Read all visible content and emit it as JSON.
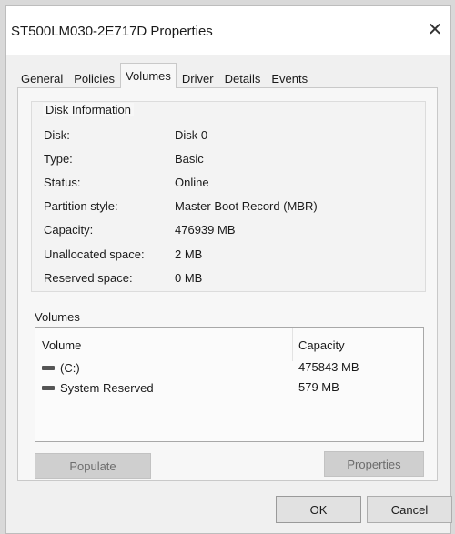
{
  "window": {
    "title": "ST500LM030-2E717D Properties",
    "close_glyph": "✕"
  },
  "tabs": [
    {
      "label": "General",
      "active": false
    },
    {
      "label": "Policies",
      "active": false
    },
    {
      "label": "Volumes",
      "active": true
    },
    {
      "label": "Driver",
      "active": false
    },
    {
      "label": "Details",
      "active": false
    },
    {
      "label": "Events",
      "active": false
    }
  ],
  "disk_info": {
    "group_title": "Disk Information",
    "rows": [
      {
        "label": "Disk:",
        "value": "Disk 0"
      },
      {
        "label": "Type:",
        "value": "Basic"
      },
      {
        "label": "Status:",
        "value": "Online"
      },
      {
        "label": "Partition style:",
        "value": "Master Boot Record (MBR)"
      },
      {
        "label": "Capacity:",
        "value": "476939 MB"
      },
      {
        "label": "Unallocated space:",
        "value": "2 MB"
      },
      {
        "label": "Reserved space:",
        "value": "0 MB"
      }
    ]
  },
  "volumes": {
    "group_title": "Volumes",
    "columns": {
      "volume": "Volume",
      "capacity": "Capacity"
    },
    "rows": [
      {
        "name": "(C:)",
        "capacity": "475843 MB",
        "icon": "drive-icon"
      },
      {
        "name": "System Reserved",
        "capacity": "579 MB",
        "icon": "drive-icon"
      }
    ]
  },
  "buttons": {
    "populate": "Populate",
    "properties": "Properties",
    "ok": "OK",
    "cancel": "Cancel"
  }
}
